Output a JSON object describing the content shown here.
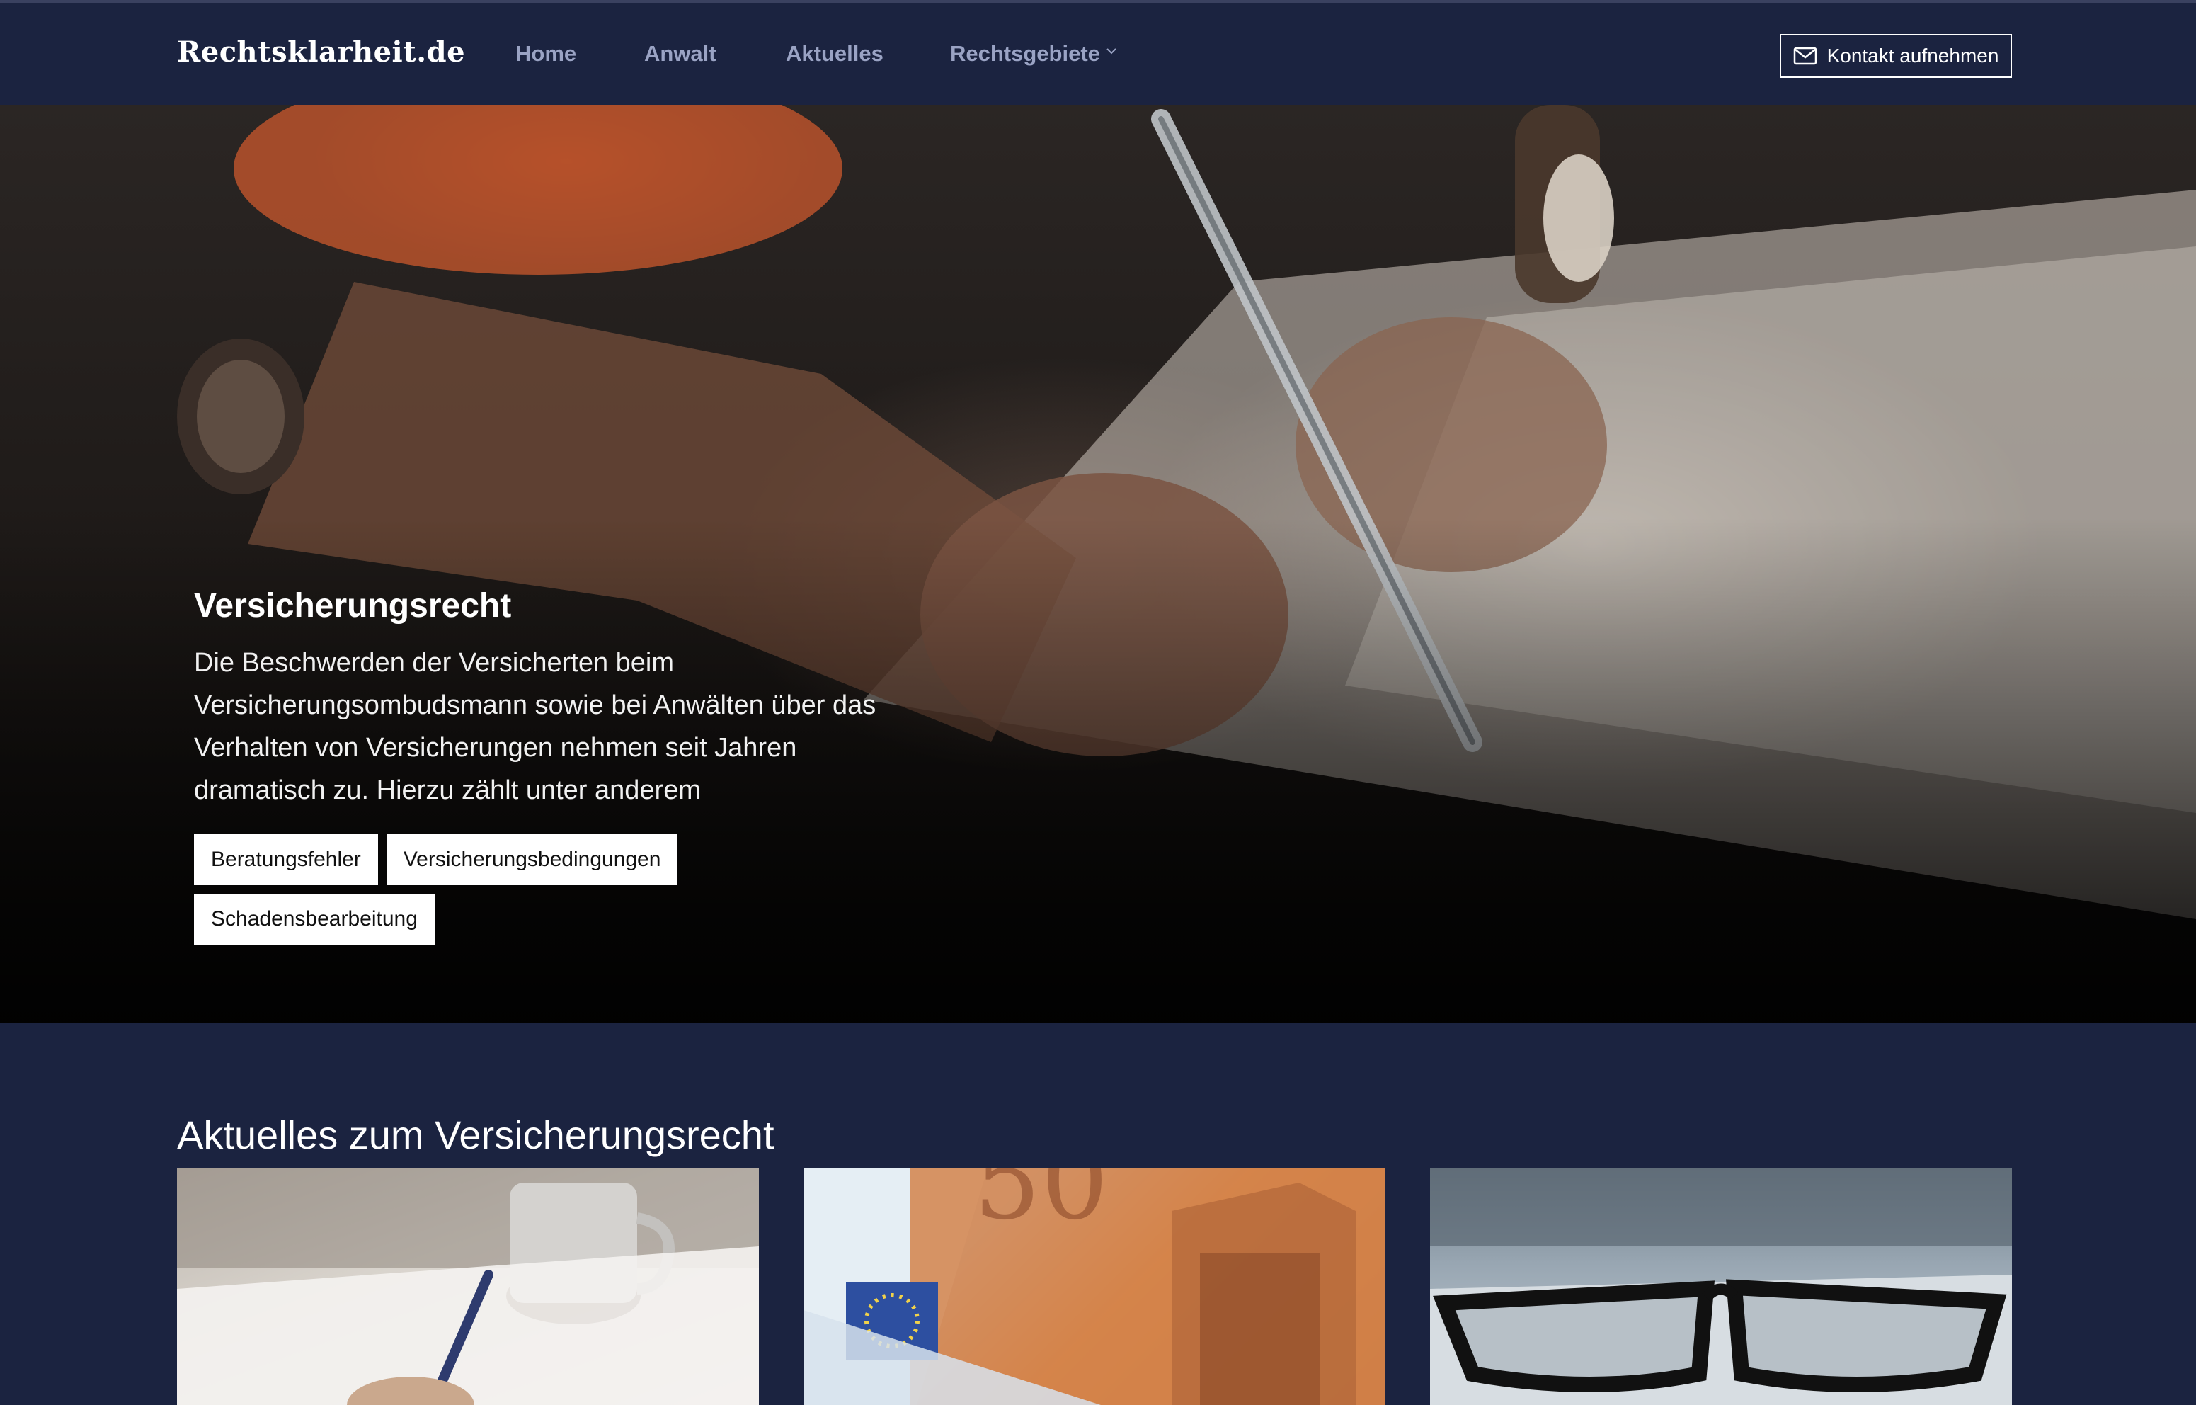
{
  "navbar": {
    "brand": "Rechtsklarheit.de",
    "links": [
      {
        "label": "Home"
      },
      {
        "label": "Anwalt"
      },
      {
        "label": "Aktuelles"
      },
      {
        "label": "Rechtsgebiete"
      }
    ],
    "contact_label": "Kontakt aufnehmen"
  },
  "hero": {
    "title": "Versicherungsrecht",
    "text": "Die Beschwerden der Versicherten beim Versicherungsombudsmann sowie bei Anwälten über das Verhalten von Versicherungen nehmen seit Jahren dramatisch zu. Hierzu zählt unter anderem",
    "tags": [
      {
        "label": "Beratungsfehler"
      },
      {
        "label": "Versicherungsbedingungen"
      },
      {
        "label": "Schadensbearbeitung"
      }
    ]
  },
  "news": {
    "title": "Aktuelles zum Versicherungsrecht"
  },
  "colors": {
    "navbar_bg": "#1b2340",
    "nav_link": "#9aa3c4",
    "text_white": "#ffffff"
  },
  "icons": {
    "contact": "mail-icon",
    "dropdown": "chevron-down-icon"
  }
}
